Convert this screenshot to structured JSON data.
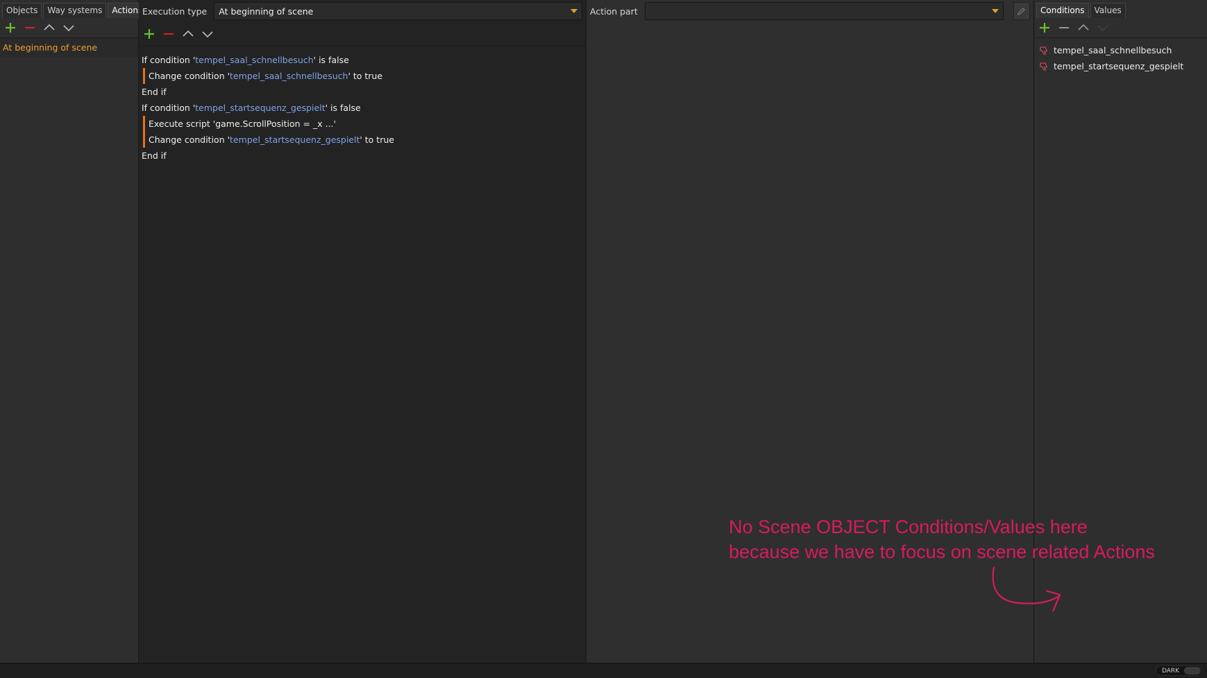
{
  "left_panel": {
    "tabs": [
      {
        "label": "Objects",
        "active": false
      },
      {
        "label": "Way systems",
        "active": false
      },
      {
        "label": "Actions",
        "active": true
      }
    ],
    "toolbar": [
      "add-icon",
      "remove-icon",
      "move-up-icon",
      "move-down-icon"
    ],
    "items": [
      {
        "label": "At beginning of scene",
        "selected": true
      }
    ]
  },
  "center_panel": {
    "execution_type_label": "Execution type",
    "execution_type_value": "At beginning of scene",
    "toolbar": [
      "add-icon",
      "remove-icon",
      "move-up-icon",
      "move-down-icon"
    ],
    "lines": [
      {
        "pre": "If condition '",
        "cond": "tempel_saal_schnellbesuch",
        "post": "' is false",
        "indent": false
      },
      {
        "pre": "Change condition '",
        "cond": "tempel_saal_schnellbesuch",
        "post": "' to true",
        "indent": true
      },
      {
        "pre": "End if",
        "cond": "",
        "post": "",
        "indent": false
      },
      {
        "pre": "If condition '",
        "cond": "tempel_startsequenz_gespielt",
        "post": "' is false",
        "indent": false
      },
      {
        "pre": "Execute script 'game.ScrollPosition = _x ...'",
        "cond": "",
        "post": "",
        "indent": true
      },
      {
        "pre": "Change condition '",
        "cond": "tempel_startsequenz_gespielt",
        "post": "' to true",
        "indent": true
      },
      {
        "pre": "End if",
        "cond": "",
        "post": "",
        "indent": false
      }
    ]
  },
  "action_part": {
    "label": "Action part",
    "value": ""
  },
  "right_panel": {
    "tabs": [
      {
        "label": "Conditions",
        "active": true
      },
      {
        "label": "Values",
        "active": false
      }
    ],
    "toolbar": [
      "add-icon",
      "remove-icon",
      "move-up-icon",
      "move-down-icon"
    ],
    "conditions": [
      {
        "label": "tempel_saal_schnellbesuch",
        "icon": "thumbs-down-icon"
      },
      {
        "label": "tempel_startsequenz_gespielt",
        "icon": "thumbs-down-icon"
      }
    ]
  },
  "status_bar": {
    "theme_toggle_label": "DARK"
  },
  "annotation": {
    "line1": "No Scene OBJECT Conditions/Values here",
    "line2": "because we have to focus on scene related Actions"
  },
  "colors": {
    "accent_orange": "#f0a02a",
    "add_green": "#6bbf2a",
    "remove_red": "#d42020",
    "condition_blue": "#7fa3e6",
    "annotation_pink": "#d81b60"
  }
}
